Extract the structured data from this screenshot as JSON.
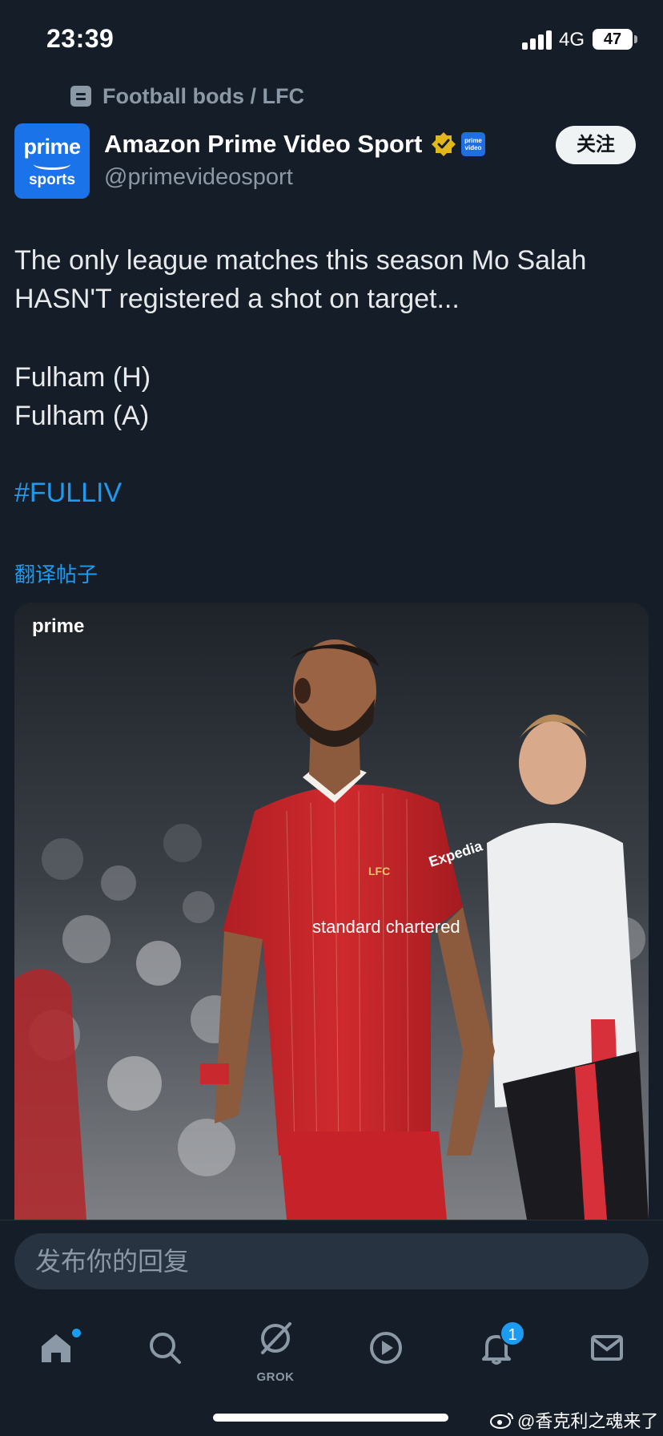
{
  "status_bar": {
    "time": "23:39",
    "network": "4G",
    "battery": "47"
  },
  "community": {
    "label": "Football bods / LFC",
    "icon": "community-icon"
  },
  "author": {
    "avatar_text_top": "prime",
    "avatar_text_bottom": "sports",
    "name": "Amazon Prime Video Sport",
    "handle": "@primevideosport",
    "verified": true,
    "affiliate_badge": "prime video",
    "follow_label": "关注"
  },
  "tweet": {
    "lines": [
      "The only league matches this season Mo Salah",
      "HASN'T registered a shot on target..."
    ],
    "matches": [
      "Fulham (H)",
      "Fulham (A)"
    ],
    "hashtag": "#FULLIV",
    "translate": "翻译帖子"
  },
  "media": {
    "logo": "prime",
    "kit_sponsor": "standard chartered",
    "sleeve_sponsor": "Expedia",
    "crest": "LFC"
  },
  "reply": {
    "placeholder": "发布你的回复"
  },
  "nav": {
    "items": [
      "home-icon",
      "search-icon",
      "grok-icon",
      "video-icon",
      "notifications-icon",
      "messages-icon"
    ],
    "grok_label": "GROK",
    "notifications_count": "1"
  },
  "watermark": "@香克利之魂来了",
  "colors": {
    "background": "#151d29",
    "accent": "#1d9bf0",
    "secondary_text": "#8b98a5"
  }
}
